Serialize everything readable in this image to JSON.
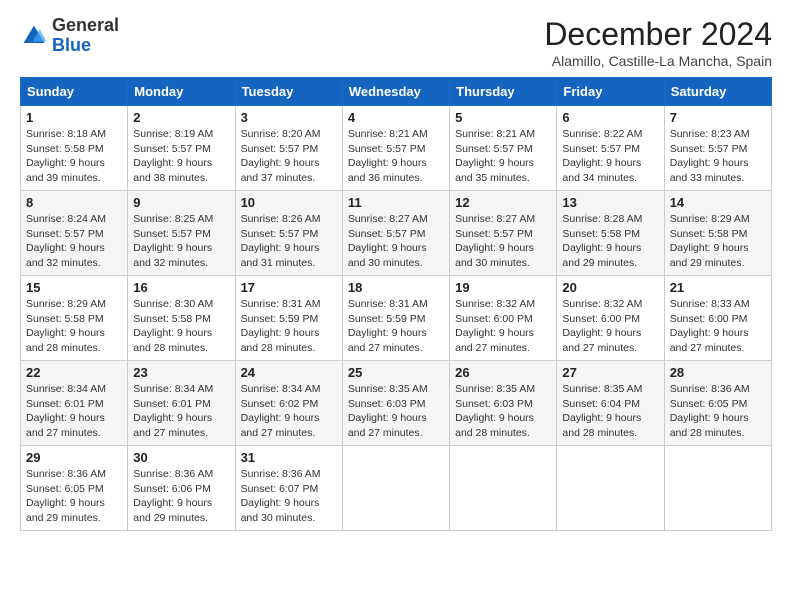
{
  "header": {
    "logo_general": "General",
    "logo_blue": "Blue",
    "month_title": "December 2024",
    "subtitle": "Alamillo, Castille-La Mancha, Spain"
  },
  "weekdays": [
    "Sunday",
    "Monday",
    "Tuesday",
    "Wednesday",
    "Thursday",
    "Friday",
    "Saturday"
  ],
  "weeks": [
    [
      {
        "day": "1",
        "sunrise": "8:18 AM",
        "sunset": "5:58 PM",
        "daylight": "9 hours and 39 minutes."
      },
      {
        "day": "2",
        "sunrise": "8:19 AM",
        "sunset": "5:57 PM",
        "daylight": "9 hours and 38 minutes."
      },
      {
        "day": "3",
        "sunrise": "8:20 AM",
        "sunset": "5:57 PM",
        "daylight": "9 hours and 37 minutes."
      },
      {
        "day": "4",
        "sunrise": "8:21 AM",
        "sunset": "5:57 PM",
        "daylight": "9 hours and 36 minutes."
      },
      {
        "day": "5",
        "sunrise": "8:21 AM",
        "sunset": "5:57 PM",
        "daylight": "9 hours and 35 minutes."
      },
      {
        "day": "6",
        "sunrise": "8:22 AM",
        "sunset": "5:57 PM",
        "daylight": "9 hours and 34 minutes."
      },
      {
        "day": "7",
        "sunrise": "8:23 AM",
        "sunset": "5:57 PM",
        "daylight": "9 hours and 33 minutes."
      }
    ],
    [
      {
        "day": "8",
        "sunrise": "8:24 AM",
        "sunset": "5:57 PM",
        "daylight": "9 hours and 32 minutes."
      },
      {
        "day": "9",
        "sunrise": "8:25 AM",
        "sunset": "5:57 PM",
        "daylight": "9 hours and 32 minutes."
      },
      {
        "day": "10",
        "sunrise": "8:26 AM",
        "sunset": "5:57 PM",
        "daylight": "9 hours and 31 minutes."
      },
      {
        "day": "11",
        "sunrise": "8:27 AM",
        "sunset": "5:57 PM",
        "daylight": "9 hours and 30 minutes."
      },
      {
        "day": "12",
        "sunrise": "8:27 AM",
        "sunset": "5:57 PM",
        "daylight": "9 hours and 30 minutes."
      },
      {
        "day": "13",
        "sunrise": "8:28 AM",
        "sunset": "5:58 PM",
        "daylight": "9 hours and 29 minutes."
      },
      {
        "day": "14",
        "sunrise": "8:29 AM",
        "sunset": "5:58 PM",
        "daylight": "9 hours and 29 minutes."
      }
    ],
    [
      {
        "day": "15",
        "sunrise": "8:29 AM",
        "sunset": "5:58 PM",
        "daylight": "9 hours and 28 minutes."
      },
      {
        "day": "16",
        "sunrise": "8:30 AM",
        "sunset": "5:58 PM",
        "daylight": "9 hours and 28 minutes."
      },
      {
        "day": "17",
        "sunrise": "8:31 AM",
        "sunset": "5:59 PM",
        "daylight": "9 hours and 28 minutes."
      },
      {
        "day": "18",
        "sunrise": "8:31 AM",
        "sunset": "5:59 PM",
        "daylight": "9 hours and 27 minutes."
      },
      {
        "day": "19",
        "sunrise": "8:32 AM",
        "sunset": "6:00 PM",
        "daylight": "9 hours and 27 minutes."
      },
      {
        "day": "20",
        "sunrise": "8:32 AM",
        "sunset": "6:00 PM",
        "daylight": "9 hours and 27 minutes."
      },
      {
        "day": "21",
        "sunrise": "8:33 AM",
        "sunset": "6:00 PM",
        "daylight": "9 hours and 27 minutes."
      }
    ],
    [
      {
        "day": "22",
        "sunrise": "8:34 AM",
        "sunset": "6:01 PM",
        "daylight": "9 hours and 27 minutes."
      },
      {
        "day": "23",
        "sunrise": "8:34 AM",
        "sunset": "6:01 PM",
        "daylight": "9 hours and 27 minutes."
      },
      {
        "day": "24",
        "sunrise": "8:34 AM",
        "sunset": "6:02 PM",
        "daylight": "9 hours and 27 minutes."
      },
      {
        "day": "25",
        "sunrise": "8:35 AM",
        "sunset": "6:03 PM",
        "daylight": "9 hours and 27 minutes."
      },
      {
        "day": "26",
        "sunrise": "8:35 AM",
        "sunset": "6:03 PM",
        "daylight": "9 hours and 28 minutes."
      },
      {
        "day": "27",
        "sunrise": "8:35 AM",
        "sunset": "6:04 PM",
        "daylight": "9 hours and 28 minutes."
      },
      {
        "day": "28",
        "sunrise": "8:36 AM",
        "sunset": "6:05 PM",
        "daylight": "9 hours and 28 minutes."
      }
    ],
    [
      {
        "day": "29",
        "sunrise": "8:36 AM",
        "sunset": "6:05 PM",
        "daylight": "9 hours and 29 minutes."
      },
      {
        "day": "30",
        "sunrise": "8:36 AM",
        "sunset": "6:06 PM",
        "daylight": "9 hours and 29 minutes."
      },
      {
        "day": "31",
        "sunrise": "8:36 AM",
        "sunset": "6:07 PM",
        "daylight": "9 hours and 30 minutes."
      },
      null,
      null,
      null,
      null
    ]
  ],
  "labels": {
    "sunrise": "Sunrise:",
    "sunset": "Sunset:",
    "daylight": "Daylight:"
  }
}
